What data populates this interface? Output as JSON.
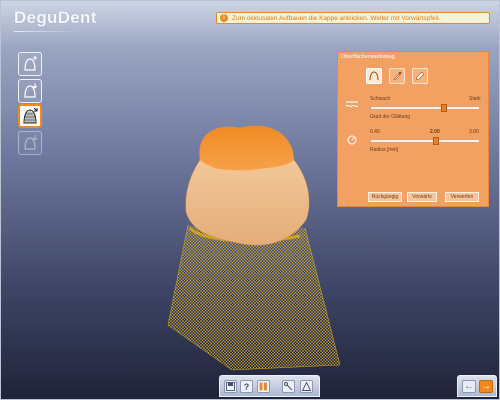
{
  "app": {
    "logo": "DeguDent"
  },
  "info_bar": {
    "text": "Zum okklusalen Aufbauen die Kappe anklicken. Weiter mit Vorwärtspfeil."
  },
  "left_toolbar": {
    "buttons": [
      {
        "icon": "cap-plus-icon",
        "state": "normal"
      },
      {
        "icon": "cap-down-icon",
        "state": "normal"
      },
      {
        "icon": "mesh-tool-icon",
        "state": "active"
      },
      {
        "icon": "cap-disabled-icon",
        "state": "disabled"
      }
    ]
  },
  "panel": {
    "title": "Oberflächenwerkzeug",
    "tools": [
      "cap-tool-icon",
      "brush-tool-icon",
      "pen-tool-icon"
    ],
    "smoothing": {
      "left_label": "Schwach",
      "right_label": "Stark",
      "caption": "Grad der Glättung",
      "level": 0.68
    },
    "radius": {
      "min_label": "0.40",
      "value_label": "2.00",
      "max_label": "3.00",
      "caption": "Radius [mm]"
    },
    "buttons": {
      "undo": "Rückgängig",
      "preview": "Vorwärts",
      "apply": "Verwerfen"
    }
  },
  "bottom_toolbar": {
    "buttons": [
      "save-icon",
      "help-icon",
      "columns-icon",
      "tools-icon",
      "warning-icon"
    ]
  },
  "nav": {
    "back": "←",
    "forward": "→"
  },
  "colors": {
    "accent": "#f08a1d",
    "panel": "#f2a162",
    "crown": "#f5c99a",
    "mesh": "#e8b61a"
  }
}
